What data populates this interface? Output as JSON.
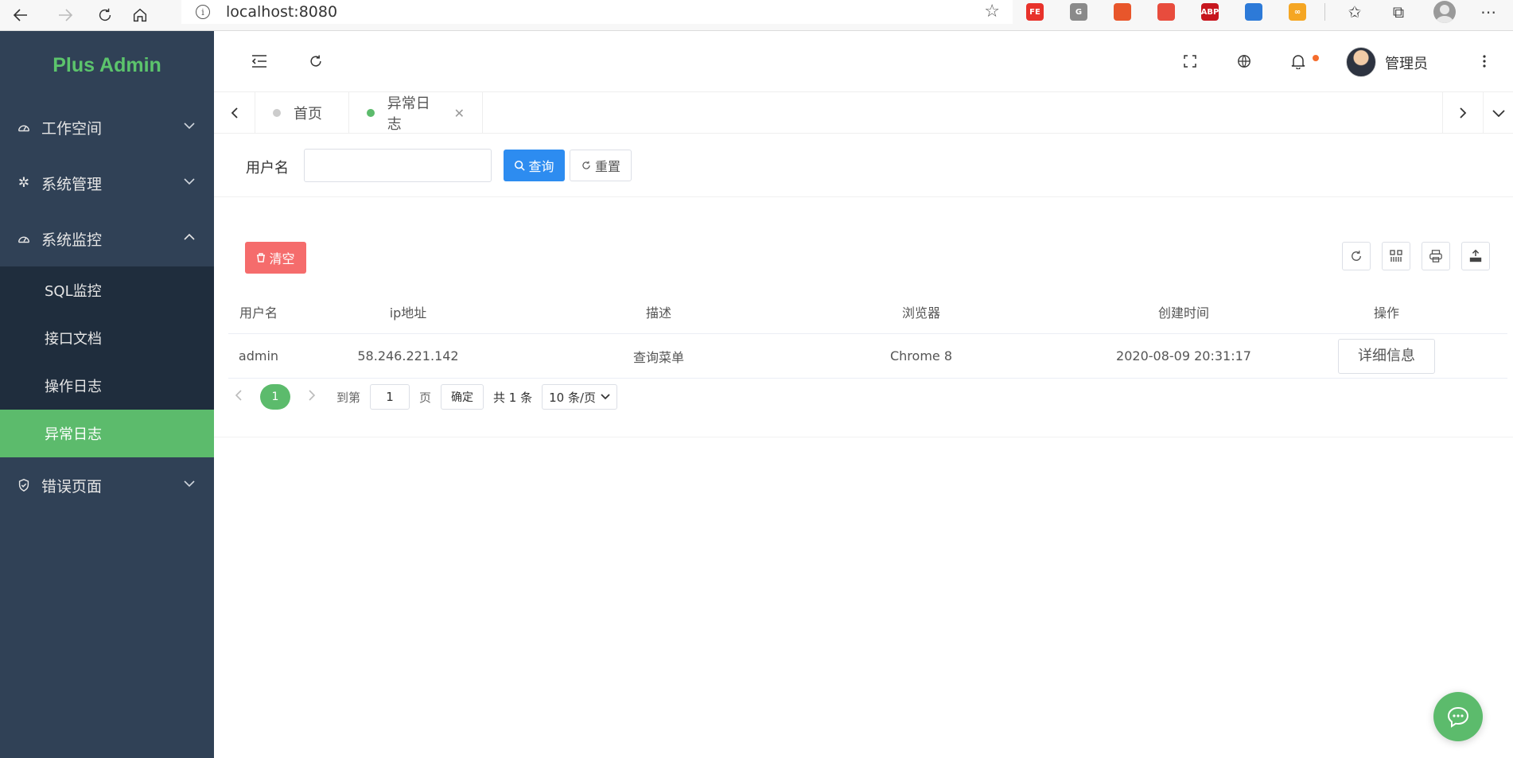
{
  "browser": {
    "url": "localhost:8080",
    "info_icon": "i",
    "extensions": [
      {
        "name": "fe-extension-icon",
        "label": "FE",
        "color": "#e8322b"
      },
      {
        "name": "grammarly-icon",
        "label": "G",
        "color": "#8a8a8a"
      },
      {
        "name": "extension-graph-icon",
        "label": "",
        "color": "#e8562b"
      },
      {
        "name": "extension-box-icon",
        "label": "",
        "color": "#e84c3d"
      },
      {
        "name": "adblock-plus-icon",
        "label": "ABP",
        "color": "#c7161e"
      },
      {
        "name": "extension-blue-icon",
        "label": "",
        "color": "#2d7ad8"
      },
      {
        "name": "extension-infinity-icon",
        "label": "∞",
        "color": "#f5a623"
      }
    ]
  },
  "sidebar": {
    "logo": "Plus Admin",
    "menu": [
      {
        "label": "工作空间",
        "icon": "dashboard-icon",
        "expanded": false
      },
      {
        "label": "系统管理",
        "icon": "gear-icon",
        "expanded": false
      },
      {
        "label": "系统监控",
        "icon": "dashboard-icon",
        "expanded": true,
        "children": [
          {
            "label": "SQL监控"
          },
          {
            "label": "接口文档"
          },
          {
            "label": "操作日志"
          },
          {
            "label": "异常日志",
            "active": true
          }
        ]
      },
      {
        "label": "错误页面",
        "icon": "shield-icon",
        "expanded": false
      }
    ]
  },
  "header": {
    "user_name": "管理员"
  },
  "tabs": [
    {
      "label": "首页",
      "active": false
    },
    {
      "label": "异常日志",
      "active": true,
      "close": "✕"
    }
  ],
  "search": {
    "label": "用户名",
    "value": "",
    "query_label": "查询",
    "reset_label": "重置"
  },
  "toolbar": {
    "clear_label": "清空"
  },
  "table": {
    "columns": [
      "用户名",
      "ip地址",
      "描述",
      "浏览器",
      "创建时间",
      "操作"
    ],
    "rows": [
      {
        "username": "admin",
        "ip": "58.246.221.142",
        "desc": "查询菜单",
        "browser": "Chrome 8",
        "created": "2020-08-09 20:31:17",
        "action": "详细信息"
      }
    ]
  },
  "pagination": {
    "current_page": "1",
    "goto_label": "到第",
    "goto_value": "1",
    "page_unit": "页",
    "confirm_label": "确定",
    "total_label": "共 1 条",
    "page_size": "10 条/页"
  },
  "colors": {
    "accent": "#5cbb6c",
    "sidebar_bg": "#304156",
    "primary": "#2d8cf0",
    "danger": "#f56c6c"
  }
}
